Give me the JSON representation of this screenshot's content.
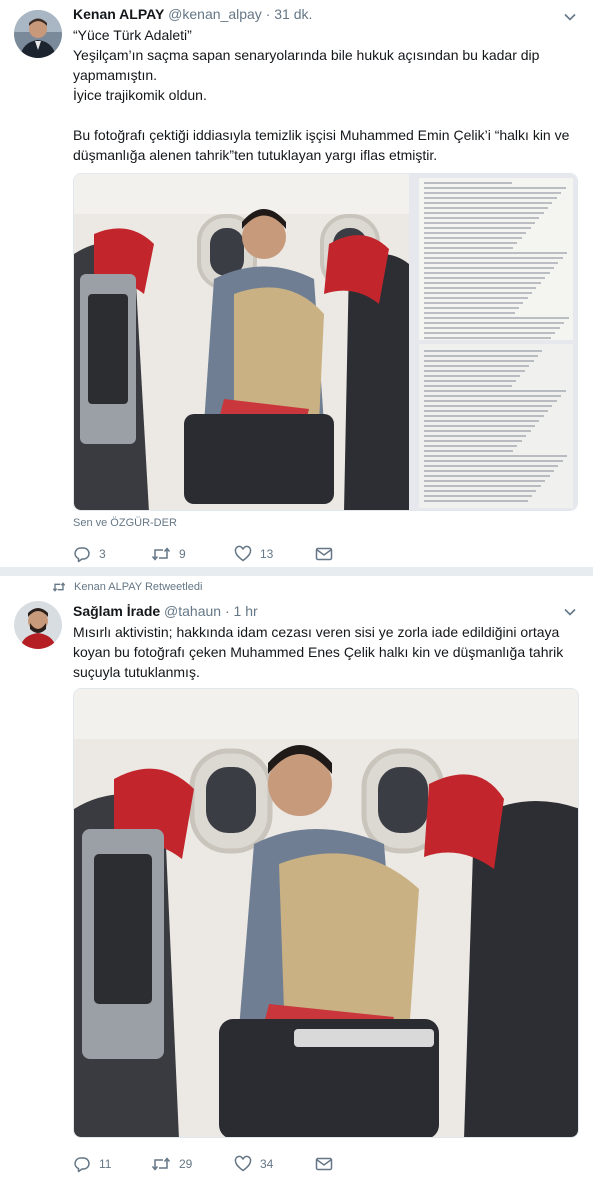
{
  "tweet1": {
    "name": "Kenan ALPAY",
    "handle": "@kenan_alpay",
    "separator": "·",
    "time": "31 dk.",
    "text_lines": [
      "“Yüce Türk Adaleti”",
      "Yeşilçam’ın saçma sapan senaryolarında bile hukuk açısından bu kadar dip",
      "yapmamıştın.",
      "İyice trajikomik oldun.",
      "",
      "Bu fotoğrafı çektiği iddiasıyla temizlik işçisi Muhammed Emin Çelik’i “halkı kin ve",
      "düşmanlığa alenen tahrik”ten tutuklayan yargı iflas etmiştir."
    ],
    "liked_by": "Sen ve ÖZGÜR-DER",
    "replies": "3",
    "retweets": "9",
    "likes": "13"
  },
  "tweet2": {
    "retweeted_by": "Kenan ALPAY Retweetledi",
    "name": "Sağlam İrade",
    "handle": "@tahaun",
    "separator": "·",
    "time": "1 hr",
    "text_lines": [
      "Mısırlı aktivistin; hakkında idam cezası veren sisi ye zorla iade edildiğini ortaya",
      "koyan bu fotoğrafı çeken Muhammed Enes Çelik halkı kin ve düşmanlığa tahrik",
      "suçuyla tutuklanmış."
    ],
    "replies": "11",
    "retweets": "29",
    "likes": "34"
  },
  "icons": {
    "reply": "reply-icon",
    "retweet": "retweet-icon",
    "like": "heart-icon",
    "dm": "envelope-icon",
    "caret": "chevron-down-icon"
  },
  "colors": {
    "text": "#14171a",
    "secondary": "#657786",
    "separator": "#e6ecf0"
  }
}
